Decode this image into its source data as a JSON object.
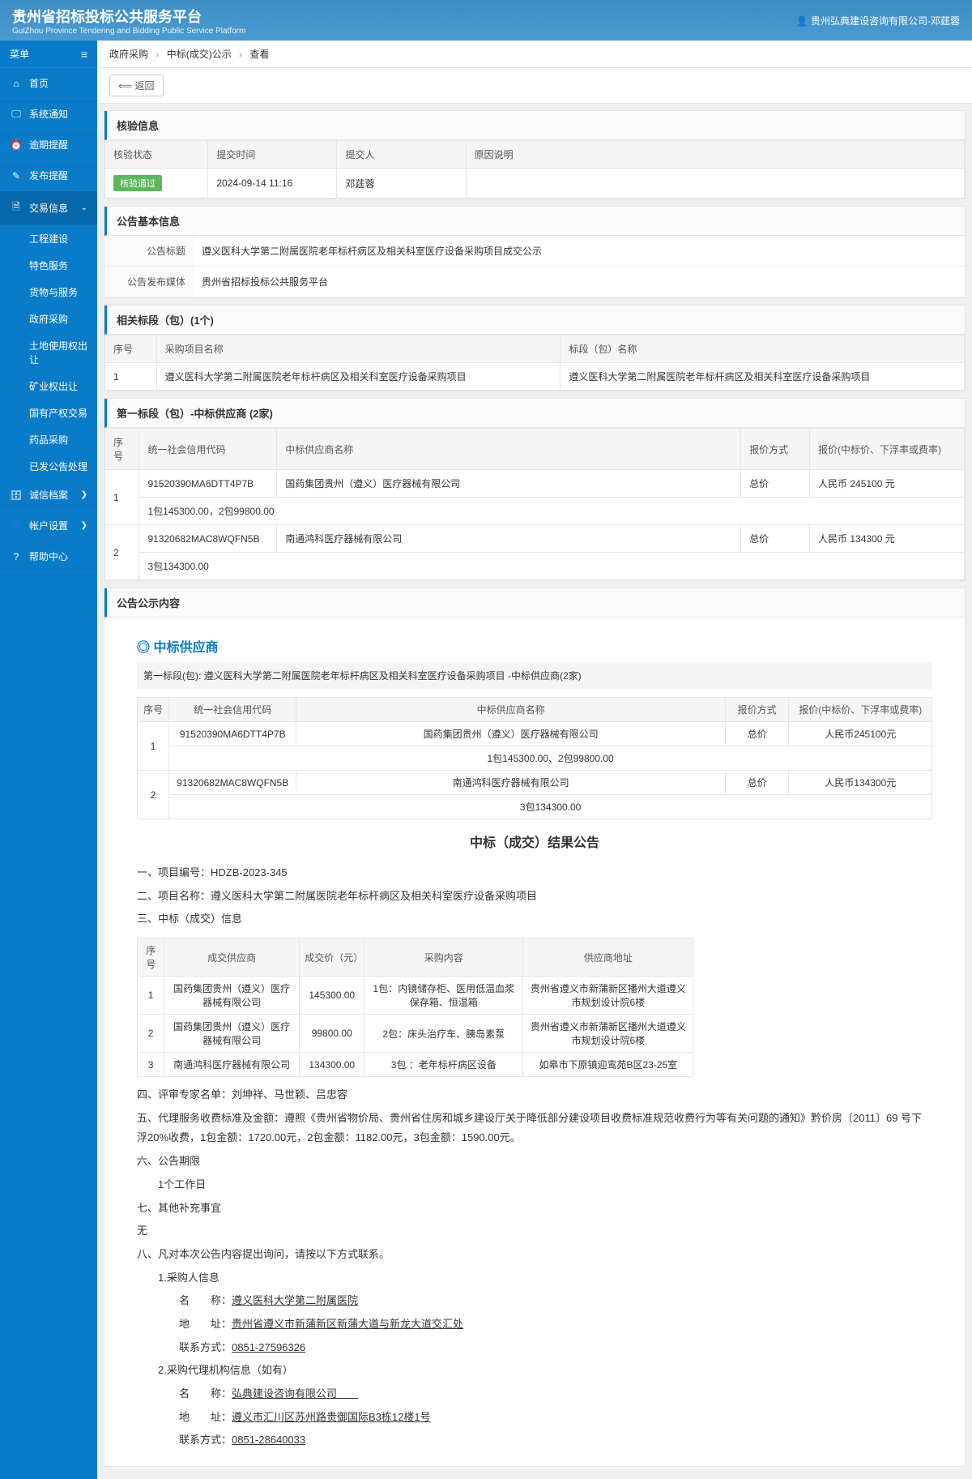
{
  "header": {
    "title": "贵州省招标投标公共服务平台",
    "subtitle": "GuiZhou Province Tendering and Bidding Public Service Platform",
    "user": "贵州弘典建设咨询有限公司-邓莛蓉"
  },
  "sidebar": {
    "menu_label": "菜单",
    "items": [
      {
        "icon": "⌂",
        "label": "首页"
      },
      {
        "icon": "🖵",
        "label": "系统通知"
      },
      {
        "icon": "⏰",
        "label": "逾期提醒"
      },
      {
        "icon": "✎",
        "label": "发布提醒"
      },
      {
        "icon": "🗎",
        "label": "交易信息",
        "active": true,
        "expand": "⌄"
      },
      {
        "icon": "🗄",
        "label": "诚信档案",
        "chev": "❯"
      },
      {
        "icon": "👤",
        "label": "帐户设置",
        "chev": "❯"
      },
      {
        "icon": "?",
        "label": "帮助中心"
      }
    ],
    "sub_items": [
      "工程建设",
      "特色服务",
      "货物与服务",
      "政府采购",
      "土地使用权出让",
      "矿业权出让",
      "国有产权交易",
      "药品采购",
      "已发公告处理"
    ]
  },
  "breadcrumb": {
    "a": "政府采购",
    "b": "中标(成交)公示",
    "c": "查看",
    "sep": "›"
  },
  "back": "⟸ 返回",
  "verify": {
    "title": "核验信息",
    "headers": [
      "核验状态",
      "提交时间",
      "提交人",
      "原因说明"
    ],
    "status": "核验通过",
    "time": "2024-09-14 11:16",
    "person": "邓莛蓉",
    "reason": ""
  },
  "basic": {
    "title": "公告基本信息",
    "label_title": "公告标题",
    "value_title": "遵义医科大学第二附属医院老年标杆病区及相关科室医疗设备采购项目成交公示",
    "label_media": "公告发布媒体",
    "value_media": "贵州省招标投标公共服务平台"
  },
  "sections": {
    "related": "相关标段（包）(1个)",
    "first_bid": "第一标段（包）-中标供应商 (2家)",
    "announce": "公告公示内容",
    "supplier": "中标供应商"
  },
  "related": {
    "headers": [
      "序号",
      "采购项目名称",
      "标段（包）名称"
    ],
    "rows": [
      {
        "no": "1",
        "proj": "遵义医科大学第二附属医院老年标杆病区及相关科室医疗设备采购项目",
        "name": "遵义医科大学第二附属医院老年标杆病区及相关科室医疗设备采购项目"
      }
    ]
  },
  "bid1": {
    "headers": [
      "序号",
      "统一社会信用代码",
      "中标供应商名称",
      "报价方式",
      "报价(中标价、下浮率或费率)"
    ],
    "rows": [
      {
        "no": "1",
        "code": "91520390MA6DTT4P7B",
        "name": "国药集团贵州（遵义）医疗器械有限公司",
        "method": "总价",
        "price": "人民币 245100 元",
        "extra": "1包145300.00，2包99800.00"
      },
      {
        "no": "2",
        "code": "91320682MAC8WQFN5B",
        "name": "南通鸿科医疗器械有限公司",
        "method": "总价",
        "price": "人民币 134300 元",
        "extra": "3包134300.00"
      }
    ]
  },
  "announce": {
    "caption": "第一标段(包): 遵义医科大学第二附属医院老年标杆病区及相关科室医疗设备采购项目 -中标供应商(2家)",
    "headers": [
      "序号",
      "统一社会信用代码",
      "中标供应商名称",
      "报价方式",
      "报价(中标价、下浮率或费率)"
    ],
    "rows": [
      {
        "no": "1",
        "code": "91520390MA6DTT4P7B",
        "name": "国药集团贵州（遵义）医疗器械有限公司",
        "method": "总价",
        "price": "人民币245100元",
        "extra": "1包145300.00、2包99800.00"
      },
      {
        "no": "2",
        "code": "91320682MAC8WQFN5B",
        "name": "南通鸿科医疗器械有限公司",
        "method": "总价",
        "price": "人民币134300元",
        "extra": "3包134300.00"
      }
    ],
    "result_title": "中标（成交）结果公告",
    "line1": "一、项目编号：HDZB-2023-345",
    "line2": "二、项目名称：遵义医科大学第二附属医院老年标杆病区及相关科室医疗设备采购项目",
    "line3": "三、中标（成交）信息",
    "deal_headers": [
      "序号",
      "成交供应商",
      "成交价（元）",
      "采购内容",
      "供应商地址"
    ],
    "deal_rows": [
      {
        "no": "1",
        "sup": "国药集团贵州（遵义）医疗器械有限公司",
        "price": "145300.00",
        "content": "1包：内镜储存柜、医用低温血浆保存箱、恒温箱",
        "addr": "贵州省遵义市新蒲新区播州大道遵义市规划设计院6楼"
      },
      {
        "no": "2",
        "sup": "国药集团贵州（遵义）医疗器械有限公司",
        "price": "99800.00",
        "content": "2包：床头治疗车、胰岛素泵",
        "addr": "贵州省遵义市新蒲新区播州大道遵义市规划设计院6楼"
      },
      {
        "no": "3",
        "sup": "南通鸿科医疗器械有限公司",
        "price": "134300.00",
        "content": "3包 ：老年标杆病区设备",
        "addr": "如皋市下原镇迎鸾苑B区23-25室"
      }
    ],
    "line4": "四、评审专家名单：刘坤祥、马世颖、吕忠容",
    "line5": "五、代理服务收费标准及金额：遵照《贵州省物价局、贵州省住房和城乡建设厅关于降低部分建设项目收费标准规范收费行为等有关问题的通知》黔价房〔2011〕69 号下浮20%收费，1包金额：1720.00元，2包金额：1182.00元，3包金额：1590.00元。",
    "line6": "六、公告期限",
    "line6b": "1个工作日",
    "line7": "七、其他补充事宜",
    "line7b": "无",
    "line8": "八、凡对本次公告内容提出询问，请按以下方式联系。",
    "buyer_h": "1.采购人信息",
    "buyer_name_l": "名　　称：",
    "buyer_name": "遵义医科大学第二附属医院",
    "buyer_addr_l": "地　　址：",
    "buyer_addr": "贵州省遵义市新蒲新区新蒲大道与新龙大道交汇处",
    "buyer_tel_l": "联系方式：",
    "buyer_tel": "0851-27596326",
    "agent_h": "2.采购代理机构信息（如有）",
    "agent_name_l": "名　　称：",
    "agent_name": "弘典建设咨询有限公司　　",
    "agent_addr_l": "地　　址：",
    "agent_addr": "遵义市汇川区苏州路贵御国际B3栋12楼1号",
    "agent_tel_l": "联系方式：",
    "agent_tel": "0851-28640033"
  }
}
